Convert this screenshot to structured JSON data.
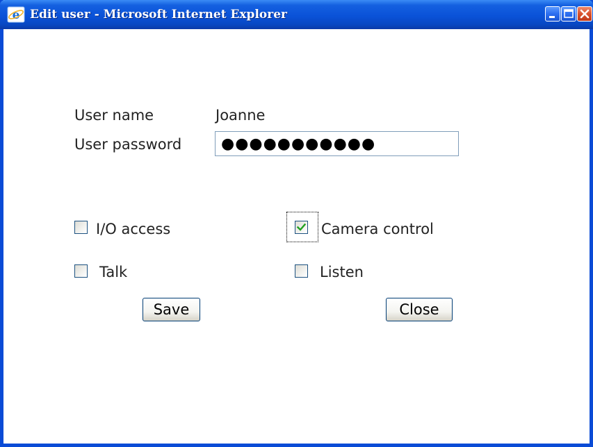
{
  "window": {
    "title": "Edit user - Microsoft Internet Explorer"
  },
  "form": {
    "user_name_label": "User name",
    "user_name_value": "Joanne",
    "password_label": "User password",
    "password_value": "●●●●●●●●●●●"
  },
  "permissions": [
    {
      "label": "I/O access",
      "checked": false
    },
    {
      "label": "Camera control",
      "checked": true
    },
    {
      "label": "Talk",
      "checked": false
    },
    {
      "label": "Listen",
      "checked": false
    }
  ],
  "buttons": {
    "save": "Save",
    "close": "Close"
  },
  "colors": {
    "titlebar": "#0a52d8",
    "frame": "#0a4bd6",
    "check_mark": "#21a121",
    "close_button": "#d9512c"
  },
  "icons": {
    "window": "ie-icon",
    "minimize": "minimize-icon",
    "maximize": "maximize-icon",
    "close": "close-icon"
  }
}
